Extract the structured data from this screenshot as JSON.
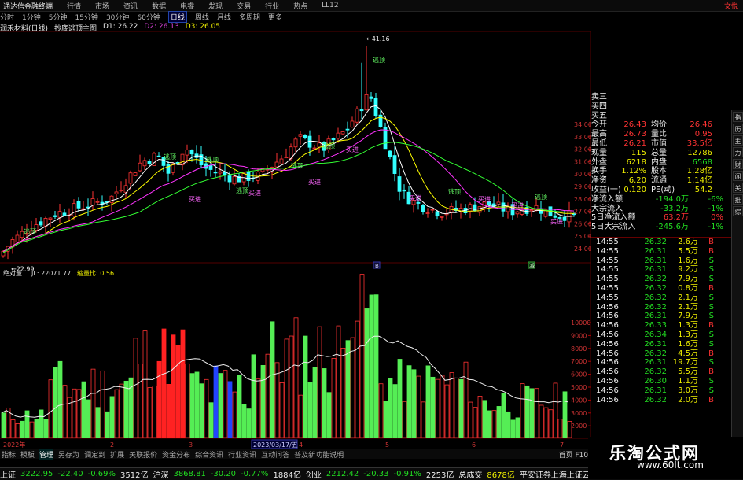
{
  "app": {
    "title": "通达信金融终端",
    "stock": "文悦"
  },
  "menu": [
    "行情",
    "市场",
    "资讯",
    "数据",
    "电睿",
    "发现",
    "交易",
    "行业",
    "热点",
    "LL12"
  ],
  "periods": [
    "分时",
    "1分钟",
    "5分钟",
    "15分钟",
    "30分钟",
    "60分钟",
    "日线",
    "周线",
    "月线",
    "多周期",
    "更多"
  ],
  "selected_period": "日线",
  "indicator_line": {
    "name": "润禾材料(日线)",
    "formula": "抄底逃顶主图",
    "v1": "D1: 26.22",
    "v2": "D2: 26.13",
    "v3": "D3: 26.05"
  },
  "price_axis": [
    "34.00",
    "33.00",
    "32.00",
    "31.00",
    "30.00",
    "29.00",
    "28.00",
    "27.00",
    "26.00",
    "25.00",
    "24.00"
  ],
  "price_labels": {
    "high": "41.16",
    "low": "22.99"
  },
  "signals": {
    "top": "逃顶",
    "bottom": "买进"
  },
  "vol_title": {
    "name": "绝对量",
    "v1": "JL: 22071.77",
    "v2": "缩量比: 0.56"
  },
  "vol_axis": [
    "10000",
    "9000",
    "8000",
    "7000",
    "6000",
    "5000",
    "4000",
    "3000",
    "2000"
  ],
  "date_axis": [
    "2022年",
    "2",
    "3",
    "4",
    "5",
    "6",
    "7"
  ],
  "date_label": "2023/03/17/五",
  "markers": [
    "B",
    "减"
  ],
  "quote": {
    "rows": [
      {
        "l": "卖三",
        "v": "",
        "l2": "",
        "v2": ""
      },
      {
        "l": "买四",
        "v": "",
        "l2": "",
        "v2": ""
      },
      {
        "l": "买五",
        "v": "",
        "l2": "",
        "v2": ""
      },
      {
        "l": "今开",
        "v": "26.43",
        "l2": "均价",
        "v2": "26.46"
      },
      {
        "l": "最高",
        "v": "26.73",
        "l2": "量比",
        "v2": "0.95"
      },
      {
        "l": "最低",
        "v": "26.21",
        "l2": "市值",
        "v2": "33.5亿"
      },
      {
        "l": "现量",
        "v": "115",
        "l2": "总量",
        "v2": "12786"
      },
      {
        "l": "外盘",
        "v": "6218",
        "l2": "内盘",
        "v2": "6568"
      },
      {
        "l": "换手",
        "v": "1.12%",
        "l2": "股本",
        "v2": "1.28亿"
      },
      {
        "l": "净资",
        "v": "6.20",
        "l2": "流通",
        "v2": "1.14亿"
      },
      {
        "l": "收益(一)",
        "v": "0.120",
        "l2": "PE(动)",
        "v2": "54.2"
      }
    ],
    "flows": [
      {
        "l": "净流入额",
        "v": "-194.0万",
        "p": "-6%"
      },
      {
        "l": "大宗流入",
        "v": "-33.2万",
        "p": "-1%"
      },
      {
        "l": "5日净流入额",
        "v": "63.2万",
        "p": "0%"
      },
      {
        "l": "5日大宗流入",
        "v": "-245.6万",
        "p": "-1%"
      }
    ]
  },
  "ticks": [
    [
      "14:55",
      "26.32",
      "2.6万",
      "B"
    ],
    [
      "14:55",
      "26.31",
      "5.5万",
      "B"
    ],
    [
      "14:55",
      "26.31",
      "1.6万",
      "S"
    ],
    [
      "14:55",
      "26.31",
      "9.2万",
      "S"
    ],
    [
      "14:55",
      "26.32",
      "7.9万",
      "S"
    ],
    [
      "14:55",
      "26.32",
      "0.8万",
      "B"
    ],
    [
      "14:55",
      "26.32",
      "2.1万",
      "S"
    ],
    [
      "14:56",
      "26.32",
      "2.1万",
      "S"
    ],
    [
      "14:56",
      "26.31",
      "7.9万",
      "S"
    ],
    [
      "14:56",
      "26.33",
      "1.3万",
      "B"
    ],
    [
      "14:56",
      "26.34",
      "1.3万",
      "S"
    ],
    [
      "14:56",
      "26.31",
      "1.6万",
      "S"
    ],
    [
      "14:56",
      "26.32",
      "4.5万",
      "B"
    ],
    [
      "14:56",
      "26.31",
      "19.7万",
      "S"
    ],
    [
      "14:56",
      "26.32",
      "5.5万",
      "B"
    ],
    [
      "14:56",
      "26.30",
      "1.1万",
      "S"
    ],
    [
      "14:56",
      "26.31",
      "3.0万",
      "S"
    ],
    [
      "14:56",
      "26.32",
      "2.0万",
      "B"
    ]
  ],
  "right_tabs": [
    "指",
    "历",
    "主",
    "力",
    "财",
    "闻",
    "关",
    "推",
    "综"
  ],
  "bottom_tabs": [
    "指标",
    "模板",
    "管理",
    "另存为",
    "调定到",
    "扩展",
    "关联报价",
    "资金分布",
    "综合资讯",
    "行业资讯",
    "互动问答",
    "普及新功能说明"
  ],
  "bottom_right": "首页 F10 释",
  "status": [
    {
      "n": "上证",
      "v": "3222.95",
      "c": "-22.40",
      "p": "-0.69%",
      "a": "3512亿"
    },
    {
      "n": "沪深",
      "v": "3868.81",
      "c": "-30.20",
      "p": "-0.77%",
      "a": "1884亿"
    },
    {
      "n": "创业",
      "v": "2212.42",
      "c": "-20.33",
      "p": "-0.91%",
      "a": "2253亿"
    }
  ],
  "status_tail": {
    "label": "总成交",
    "v": "8678亿",
    "broker": "平安证券上海上证云行情"
  },
  "watermark": {
    "cn": "乐淘公式网",
    "url": "www.60lt.com"
  },
  "colors": {
    "up": "#ff3333",
    "down": "#33dd33",
    "bg": "#000000",
    "grid": "#550000"
  }
}
